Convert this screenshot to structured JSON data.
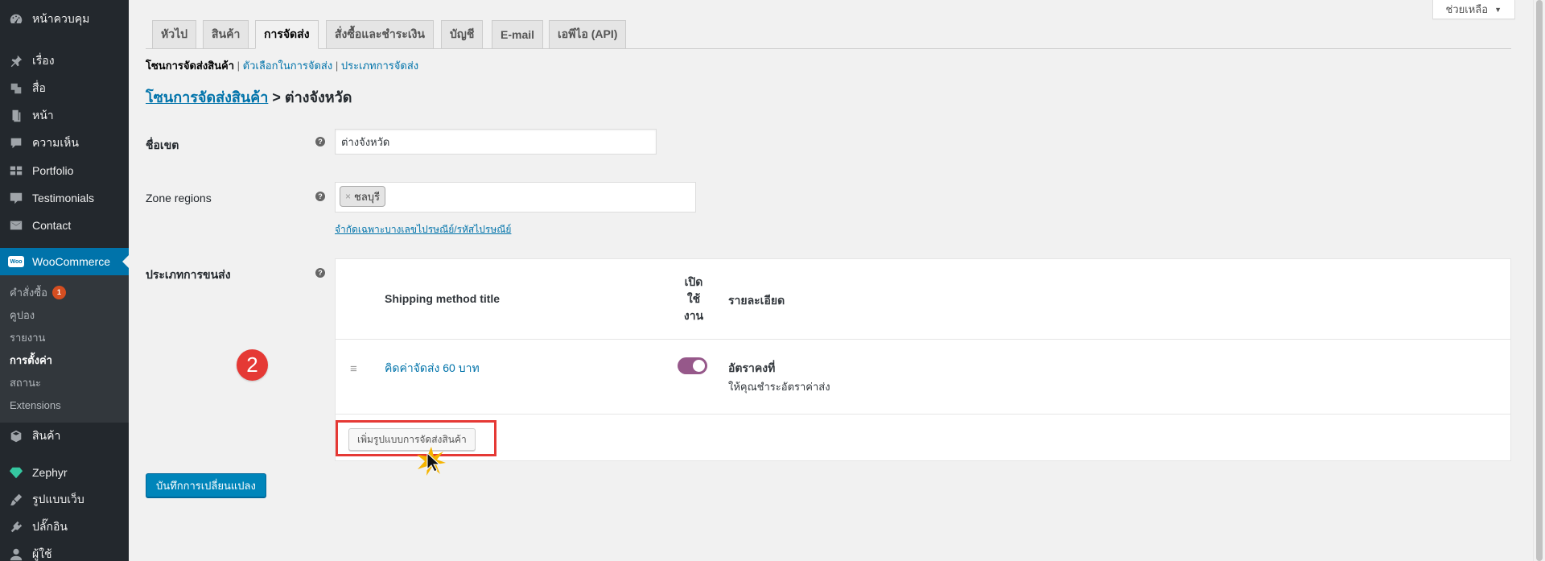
{
  "sidebar": {
    "items": [
      {
        "label": "หน้าควบคุม",
        "icon": "dashboard-icon"
      },
      {
        "label": "เรื่อง",
        "icon": "pin-icon"
      },
      {
        "label": "สื่อ",
        "icon": "media-icon"
      },
      {
        "label": "หน้า",
        "icon": "page-icon"
      },
      {
        "label": "ความเห็น",
        "icon": "comment-icon"
      },
      {
        "label": "Portfolio",
        "icon": "portfolio-icon"
      },
      {
        "label": "Testimonials",
        "icon": "testimonial-icon"
      },
      {
        "label": "Contact",
        "icon": "mail-icon"
      }
    ],
    "woocommerce": {
      "label": "WooCommerce",
      "logo": "Woo"
    },
    "submenu": [
      {
        "label": "คำสั่งซื้อ",
        "badge": "1"
      },
      {
        "label": "คูปอง"
      },
      {
        "label": "รายงาน"
      },
      {
        "label": "การตั้งค่า"
      },
      {
        "label": "สถานะ"
      },
      {
        "label": "Extensions"
      }
    ],
    "bottom_items": [
      {
        "label": "สินค้า",
        "icon": "product-icon"
      },
      {
        "label": "Zephyr",
        "icon": "diamond-icon"
      },
      {
        "label": "รูปแบบเว็บ",
        "icon": "appearance-icon"
      },
      {
        "label": "ปลั๊กอิน",
        "icon": "plugin-icon"
      },
      {
        "label": "ผู้ใช้",
        "icon": "user-icon"
      }
    ]
  },
  "help_button": {
    "label": "ช่วยเหลือ"
  },
  "tabs": [
    "หัวไป",
    "สินค้า",
    "การจัดส่ง",
    "สั่งซื้อและชำระเงิน",
    "บัญชี",
    "E-mail",
    "เอพีไอ (API)"
  ],
  "active_tab": "การจัดส่ง",
  "subnav": {
    "current": "โซนการจัดส่งสินค้า",
    "links": [
      "ตัวเลือกในการจัดส่ง",
      "ประเภทการจัดส่ง"
    ]
  },
  "heading": {
    "zones_link": "โซนการจัดส่งสินค้า",
    "separator": ">",
    "zone_name": "ต่างจังหวัด"
  },
  "form": {
    "zone_name_label": "ชื่อเขต",
    "zone_name_value": "ต่างจังหวัด",
    "zone_regions_label": "Zone regions",
    "region_chip": "ชลบุรี",
    "postcode_link": "จำกัดเฉพาะบางเลขไปรษณีย์/รหัสไปรษณีย์",
    "methods_label": "ประเภทการขนส่ง"
  },
  "methods_table": {
    "col_title": "Shipping method title",
    "col_enabled": "เปิดใช้งาน",
    "col_enabled_lines": [
      "เปิด",
      "ใช้",
      "งาน"
    ],
    "col_description": "รายละเอียด",
    "rows": [
      {
        "title": "คิดค่าจัดส่ง 60 บาท",
        "enabled": true,
        "name": "อัตราคงที่",
        "description": "ให้คุณชำระอัตราค่าส่ง"
      }
    ],
    "add_button": "เพิ่มรูปแบบการจัดส่งสินค้า"
  },
  "step_number": "2",
  "save_button": "บันทึกการเปลี่ยนแปลง",
  "colors": {
    "sidebar_bg": "#23282d",
    "active_menu": "#0073aa",
    "link": "#0073aa",
    "toggle_on": "#96588a",
    "highlight_red": "#e53935",
    "primary_button": "#0085ba"
  }
}
